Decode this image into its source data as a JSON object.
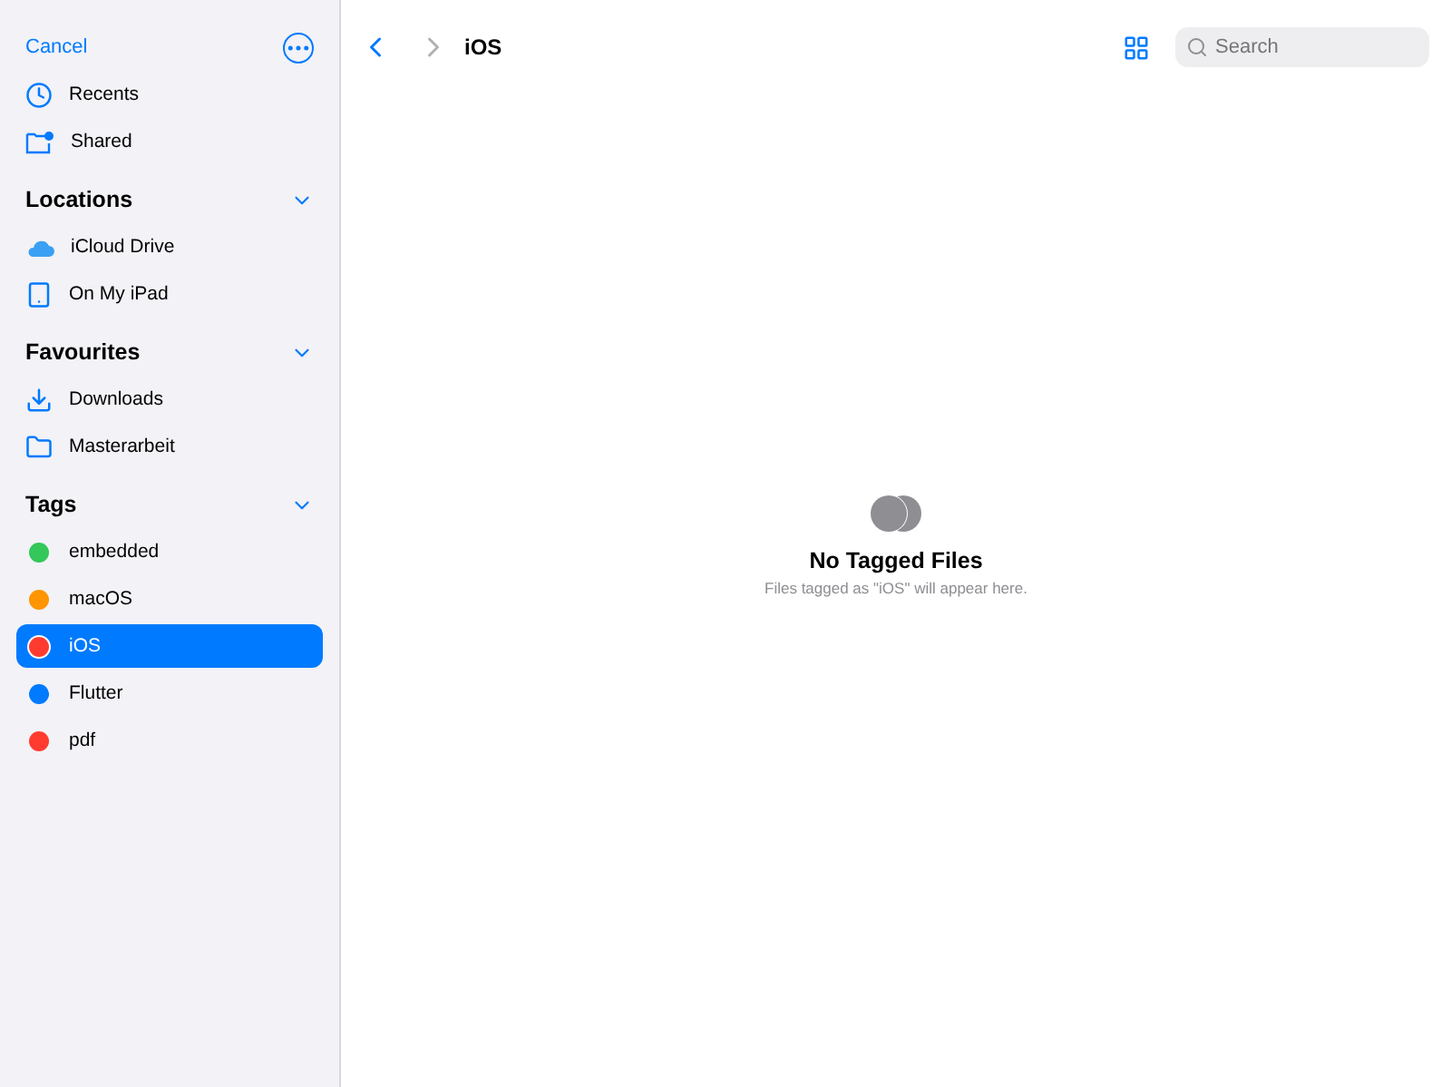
{
  "sidebar": {
    "cancel": "Cancel",
    "top_items": [
      {
        "label": "Recents",
        "kind": "clock"
      },
      {
        "label": "Shared",
        "kind": "shared"
      }
    ],
    "sections": [
      {
        "title": "Locations",
        "expanded": true,
        "items": [
          {
            "label": "iCloud Drive",
            "kind": "cloud"
          },
          {
            "label": "On My iPad",
            "kind": "ipad"
          }
        ]
      },
      {
        "title": "Favourites",
        "expanded": true,
        "items": [
          {
            "label": "Downloads",
            "kind": "download"
          },
          {
            "label": "Masterarbeit",
            "kind": "folder"
          }
        ]
      }
    ],
    "tags": {
      "title": "Tags",
      "expanded": true,
      "items": [
        {
          "label": "embedded",
          "color": "#34c759",
          "selected": false
        },
        {
          "label": "macOS",
          "color": "#ff9500",
          "selected": false
        },
        {
          "label": "iOS",
          "color": "#ff3b30",
          "selected": true
        },
        {
          "label": "Flutter",
          "color": "#007aff",
          "selected": false
        },
        {
          "label": "pdf",
          "color": "#ff3b30",
          "selected": false
        }
      ]
    }
  },
  "toolbar": {
    "title": "iOS",
    "search_placeholder": "Search"
  },
  "empty_state": {
    "title": "No Tagged Files",
    "message": "Files tagged as \"iOS\" will appear here."
  }
}
